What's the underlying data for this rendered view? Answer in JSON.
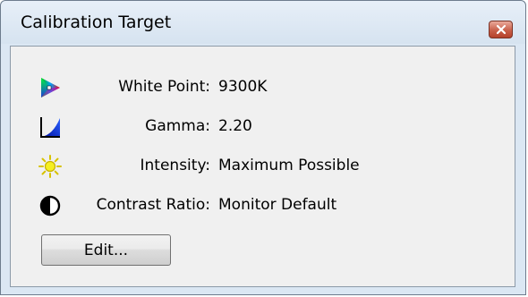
{
  "window": {
    "title": "Calibration Target"
  },
  "rows": [
    {
      "label": "White Point:",
      "value": "9300K",
      "icon": "color-gamut-icon"
    },
    {
      "label": "Gamma:",
      "value": "2.20",
      "icon": "gamma-curve-icon"
    },
    {
      "label": "Intensity:",
      "value": "Maximum Possible",
      "icon": "sun-icon"
    },
    {
      "label": "Contrast Ratio:",
      "value": "Monitor Default",
      "icon": "contrast-icon"
    }
  ],
  "edit_button": {
    "label": "Edit..."
  },
  "colors": {
    "title_bar": "#dbe7f3",
    "content_bg": "#f0f0f0",
    "close_button": "#c8604a"
  }
}
